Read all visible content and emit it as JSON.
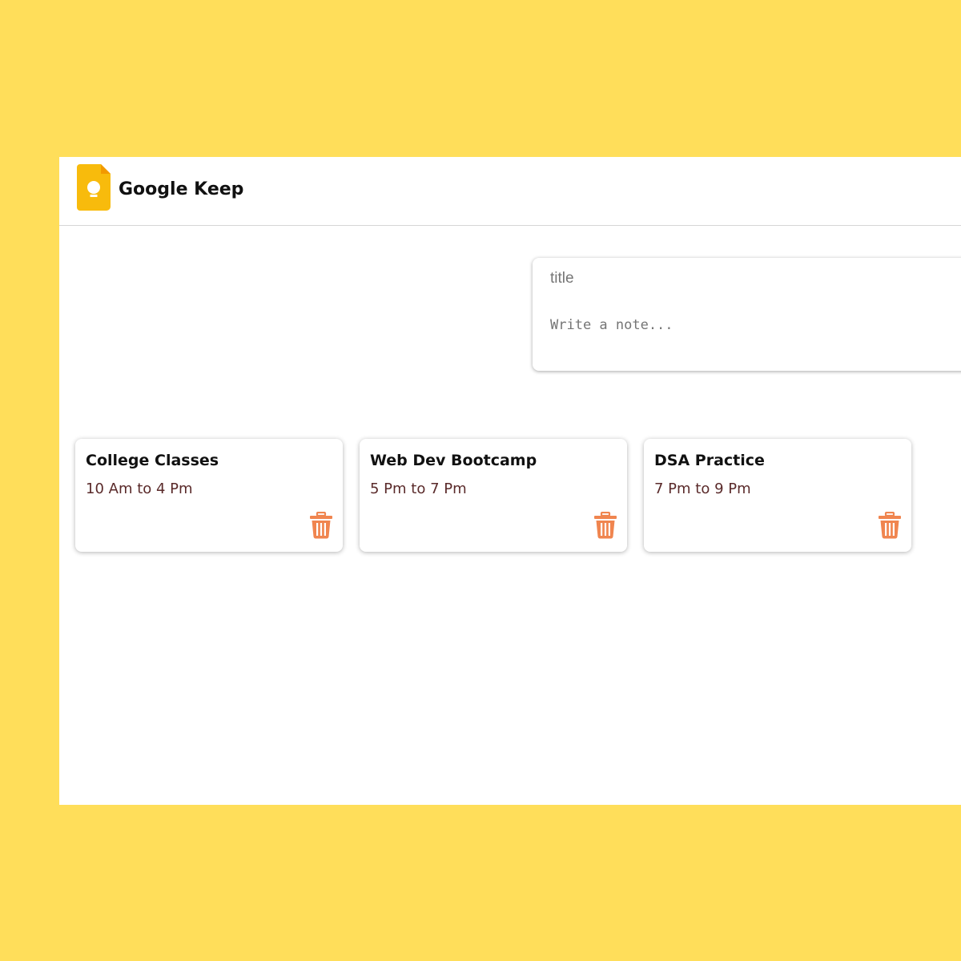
{
  "header": {
    "app_name": "Google Keep",
    "logo_icon": "google-keep-lightbulb-icon"
  },
  "composer": {
    "title_placeholder": "title",
    "content_placeholder": "Write a note..."
  },
  "notes": [
    {
      "title": "College Classes",
      "content": "10 Am to 4 Pm",
      "delete_icon": "trash-icon"
    },
    {
      "title": "Web Dev Bootcamp",
      "content": "5 Pm to 7 Pm",
      "delete_icon": "trash-icon"
    },
    {
      "title": "DSA Practice",
      "content": "7 Pm to 9 Pm",
      "delete_icon": "trash-icon"
    }
  ],
  "colors": {
    "background": "#FFDE5A",
    "logo_yellow": "#F8BB0C",
    "logo_fold": "#F29900",
    "delete_icon": "#F0854F",
    "note_content_text": "#5a2a2a"
  }
}
